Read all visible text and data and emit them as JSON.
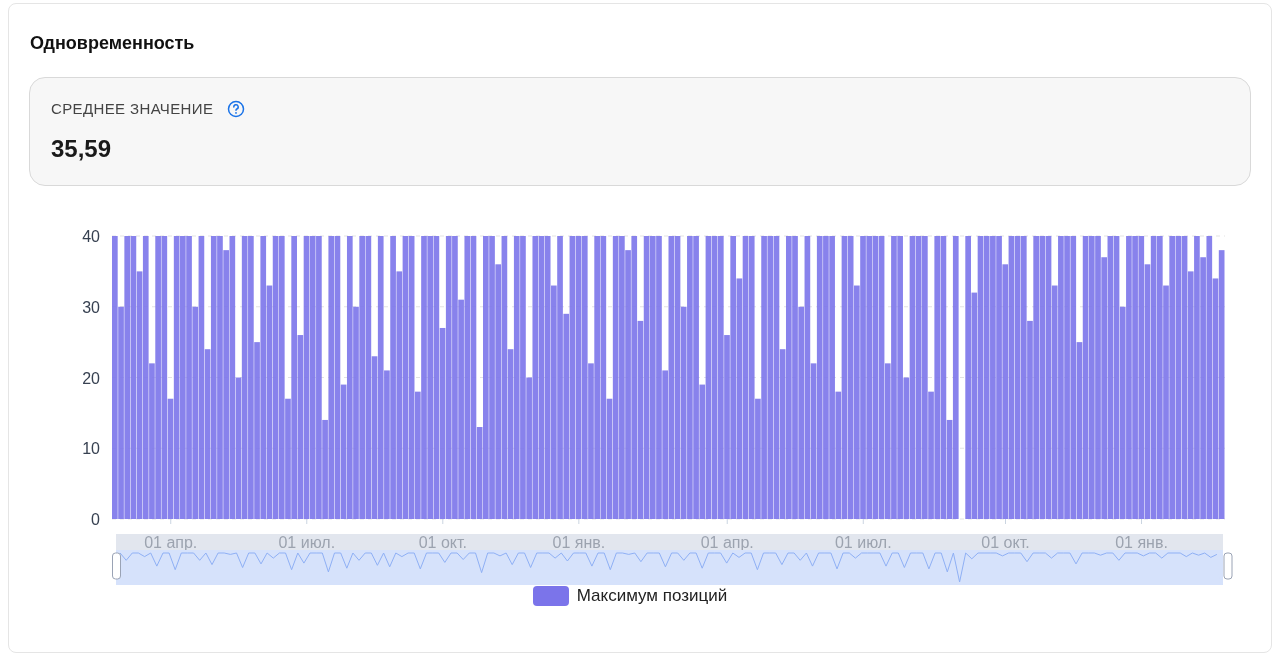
{
  "title": "Одновременность",
  "stat": {
    "label": "СРЕДНЕЕ ЗНАЧЕНИЕ",
    "value": "35,59"
  },
  "chart": {
    "chart_data": {
      "type": "bar",
      "ylim": [
        0,
        40
      ],
      "yticks": [
        0,
        10,
        20,
        30,
        40
      ],
      "grid": true,
      "categories": [
        null,
        null,
        null,
        null,
        null,
        null,
        null,
        null,
        null,
        "01 апр.",
        null,
        null,
        null,
        null,
        null,
        null,
        null,
        null,
        null,
        null,
        null,
        null,
        null,
        null,
        null,
        null,
        null,
        null,
        null,
        null,
        null,
        "01 июл.",
        null,
        null,
        null,
        null,
        null,
        null,
        null,
        null,
        null,
        null,
        null,
        null,
        null,
        null,
        null,
        null,
        null,
        null,
        null,
        null,
        null,
        "01 окт.",
        null,
        null,
        null,
        null,
        null,
        null,
        null,
        null,
        null,
        null,
        null,
        null,
        null,
        null,
        null,
        null,
        null,
        null,
        null,
        null,
        null,
        "01 янв.",
        null,
        null,
        null,
        null,
        null,
        null,
        null,
        null,
        null,
        null,
        null,
        null,
        null,
        null,
        null,
        null,
        null,
        null,
        null,
        null,
        null,
        null,
        null,
        "01 апр.",
        null,
        null,
        null,
        null,
        null,
        null,
        null,
        null,
        null,
        null,
        null,
        null,
        null,
        null,
        null,
        null,
        null,
        null,
        null,
        null,
        null,
        "01 июл.",
        null,
        null,
        null,
        null,
        null,
        null,
        null,
        null,
        null,
        null,
        null,
        null,
        null,
        null,
        null,
        null,
        null,
        null,
        null,
        null,
        null,
        null,
        "01 окт.",
        null,
        null,
        null,
        null,
        null,
        null,
        null,
        null,
        null,
        null,
        null,
        null,
        null,
        null,
        null,
        null,
        null,
        null,
        null,
        null,
        null,
        "01 янв.",
        null,
        null,
        null,
        null,
        null,
        null,
        null,
        null,
        null,
        null,
        null,
        null,
        null
      ],
      "series": [
        {
          "name": "Максимум позиций",
          "color": "#7b74ea",
          "values": [
            40,
            30,
            40,
            40,
            35,
            40,
            22,
            40,
            40,
            17,
            40,
            40,
            40,
            30,
            40,
            24,
            40,
            40,
            38,
            40,
            20,
            40,
            40,
            25,
            40,
            33,
            40,
            40,
            17,
            40,
            26,
            40,
            40,
            40,
            14,
            40,
            40,
            19,
            40,
            30,
            40,
            40,
            23,
            40,
            21,
            40,
            35,
            40,
            40,
            18,
            40,
            40,
            40,
            27,
            40,
            40,
            31,
            40,
            40,
            13,
            40,
            40,
            36,
            40,
            24,
            40,
            40,
            20,
            40,
            40,
            40,
            33,
            40,
            29,
            40,
            40,
            40,
            22,
            40,
            40,
            17,
            40,
            40,
            38,
            40,
            28,
            40,
            40,
            40,
            21,
            40,
            40,
            30,
            40,
            40,
            19,
            40,
            40,
            40,
            26,
            40,
            34,
            40,
            40,
            17,
            40,
            40,
            40,
            24,
            40,
            40,
            30,
            40,
            22,
            40,
            40,
            40,
            18,
            40,
            40,
            33,
            40,
            40,
            40,
            40,
            22,
            40,
            40,
            20,
            40,
            40,
            40,
            18,
            40,
            40,
            14,
            40,
            0,
            40,
            32,
            40,
            40,
            40,
            40,
            36,
            40,
            40,
            40,
            28,
            40,
            40,
            40,
            33,
            40,
            40,
            40,
            25,
            40,
            40,
            40,
            37,
            40,
            40,
            30,
            40,
            40,
            40,
            36,
            40,
            40,
            33,
            40,
            40,
            40,
            35,
            40,
            37,
            40,
            34,
            38
          ]
        }
      ]
    }
  }
}
